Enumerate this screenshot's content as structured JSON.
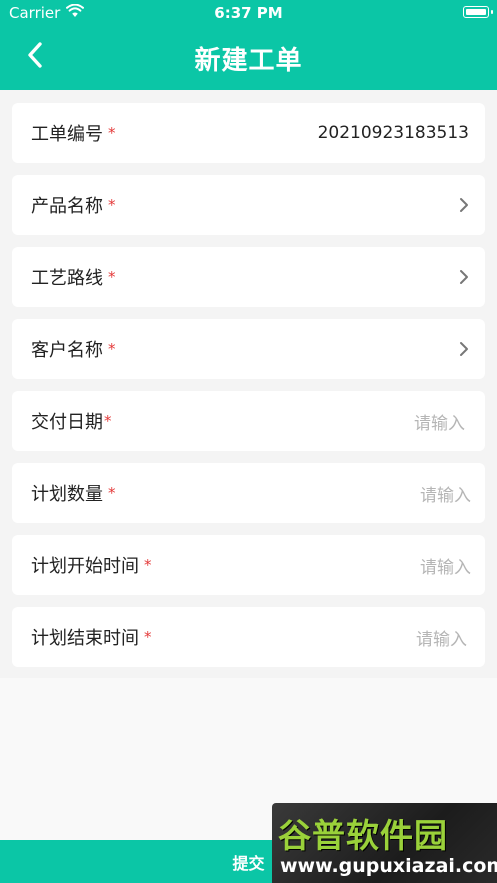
{
  "status_bar": {
    "carrier": "Carrier",
    "time": "6:37 PM"
  },
  "header": {
    "title": "新建工单",
    "back_icon": "chevron-left-icon"
  },
  "form": {
    "fields": [
      {
        "label": "工单编号",
        "required": "*",
        "value": "20210923183513"
      },
      {
        "label": "产品名称",
        "required": "*",
        "action_icon": "chevron-right-icon"
      },
      {
        "label": "工艺路线",
        "required": "*",
        "action_icon": "chevron-right-icon"
      },
      {
        "label": "客户名称",
        "required": "*",
        "action_icon": "chevron-right-icon"
      },
      {
        "label": "交付日期",
        "required": "*",
        "placeholder": "请输入"
      },
      {
        "label": "计划数量",
        "required": "*",
        "placeholder": "请输入"
      },
      {
        "label": "计划开始时间",
        "required": "*",
        "placeholder": "请输入"
      },
      {
        "label": "计划结束时间",
        "required": "*",
        "placeholder": "请输入"
      }
    ]
  },
  "footer": {
    "submit_label": "提交"
  },
  "watermark": {
    "brand": "谷普软件园",
    "url": "www.gupuxiazai.com"
  },
  "colors": {
    "accent": "#0bc6a6",
    "required": "#e43b3b",
    "placeholder": "#b5b5b5"
  }
}
